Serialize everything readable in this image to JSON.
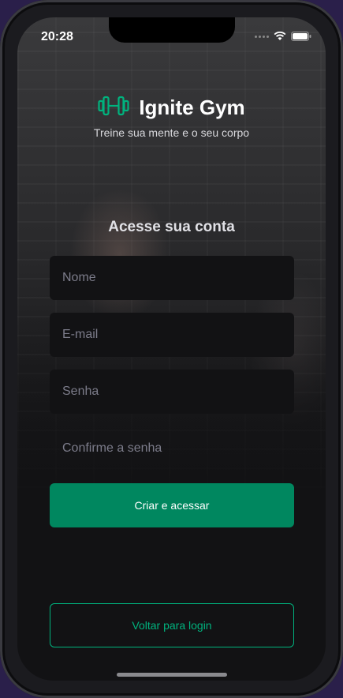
{
  "status_bar": {
    "time": "20:28"
  },
  "brand": {
    "title": "Ignite Gym",
    "tagline": "Treine sua mente e o seu corpo",
    "logo_icon": "dumbbell-icon",
    "accent": "#00b37e"
  },
  "form": {
    "heading": "Acesse sua conta",
    "fields": [
      {
        "placeholder": "Nome",
        "value": ""
      },
      {
        "placeholder": "E-mail",
        "value": ""
      },
      {
        "placeholder": "Senha",
        "value": ""
      },
      {
        "placeholder": "Confirme a senha",
        "value": ""
      }
    ],
    "submit_label": "Criar e acessar",
    "back_label": "Voltar para login"
  },
  "colors": {
    "primary": "#00875f",
    "outline": "#00b37e",
    "background": "#121214",
    "input_bg": "#121214"
  }
}
